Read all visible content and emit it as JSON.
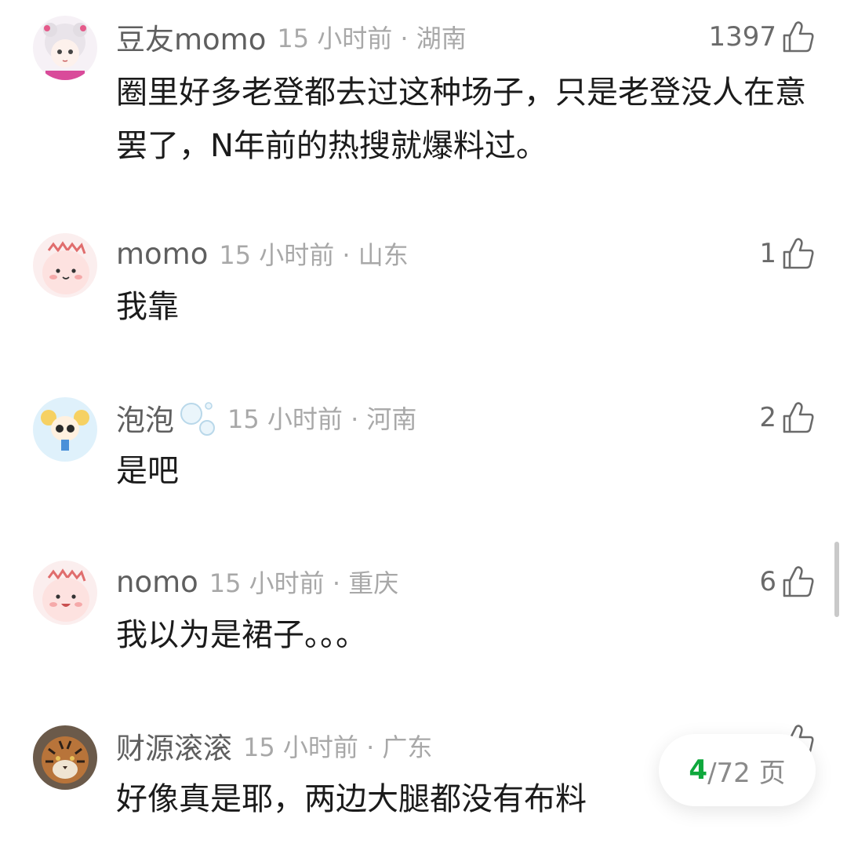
{
  "comments": [
    {
      "username": "豆友momo",
      "time_location": "15 小时前 · 湖南",
      "likes": "1397",
      "text": "圈里好多老登都去过这种场子，只是老登没人在意罢了，N年前的热搜就爆料过。"
    },
    {
      "username": "momo",
      "time_location": "15 小时前 · 山东",
      "likes": "1",
      "text": "我靠"
    },
    {
      "username": "泡泡",
      "time_location": "15 小时前 · 河南",
      "likes": "2",
      "text": "是吧"
    },
    {
      "username": "nomo",
      "time_location": "15 小时前 · 重庆",
      "likes": "6",
      "text": "我以为是裙子。。。"
    },
    {
      "username": "财源滚滚",
      "time_location": "15 小时前 · 广东",
      "likes": "",
      "text": "好像真是耶，两边大腿都没有布料"
    }
  ],
  "pager": {
    "current": "4",
    "total": "/72 页"
  },
  "icons": {
    "like": "thumbs-up-icon",
    "decoration": "bubbles-icon"
  },
  "colors": {
    "accent": "#0fa83c",
    "meta": "#a8a8a8",
    "text": "#1b1b1b"
  }
}
